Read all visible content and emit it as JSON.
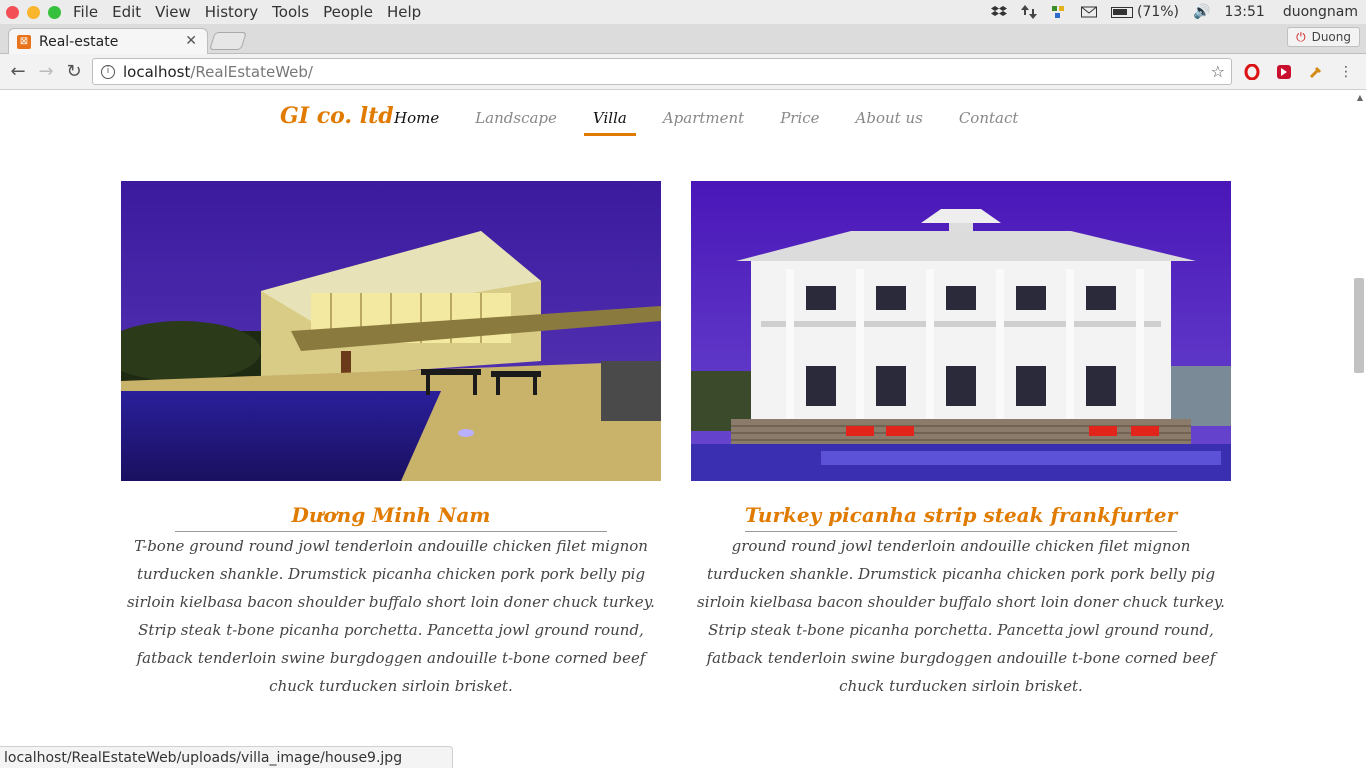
{
  "os": {
    "menus": [
      "File",
      "Edit",
      "View",
      "History",
      "Tools",
      "People",
      "Help"
    ],
    "battery": "(71%)",
    "time": "13:51",
    "user": "duongnam"
  },
  "browser": {
    "tab_title": "Real-estate",
    "profile_name": "Duong",
    "url_host": "localhost",
    "url_path": "/RealEstateWeb/",
    "status_url": "localhost/RealEstateWeb/uploads/villa_image/house9.jpg"
  },
  "site": {
    "brand": "GI co. ltd",
    "nav": [
      "Home",
      "Landscape",
      "Villa",
      "Apartment",
      "Price",
      "About us",
      "Contact"
    ],
    "active_nav": "Villa"
  },
  "cards": [
    {
      "title": "Dương Minh Nam",
      "text": "T-bone ground round jowl tenderloin andouille chicken filet mignon turducken shankle. Drumstick picanha chicken pork pork belly pig sirloin kielbasa bacon shoulder buffalo short loin doner chuck turkey. Strip steak t-bone picanha porchetta. Pancetta jowl ground round, fatback tenderloin swine burgdoggen andouille t-bone corned beef chuck turducken sirloin brisket."
    },
    {
      "title": "Turkey picanha strip steak frankfurter",
      "text": "ground round jowl tenderloin andouille chicken filet mignon turducken shankle. Drumstick picanha chicken pork pork belly pig sirloin kielbasa bacon shoulder buffalo short loin doner chuck turkey. Strip steak t-bone picanha porchetta. Pancetta jowl ground round, fatback tenderloin swine burgdoggen andouille t-bone corned beef chuck turducken sirloin brisket."
    }
  ],
  "colors": {
    "accent": "#e07b00",
    "sky": "#4a1fa8"
  }
}
